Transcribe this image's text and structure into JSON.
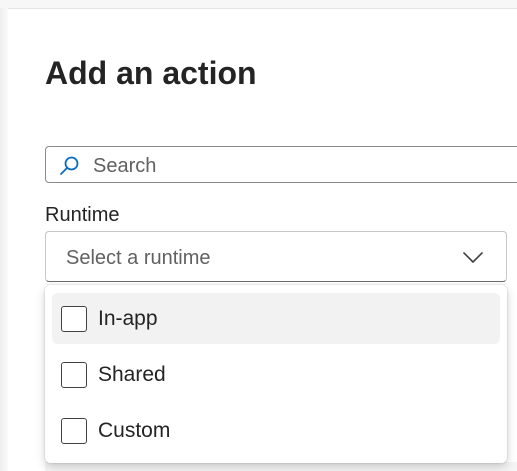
{
  "panel": {
    "title": "Add an action"
  },
  "search": {
    "placeholder": "Search",
    "icon": "search-icon"
  },
  "runtime": {
    "label": "Runtime",
    "placeholder": "Select a runtime",
    "icon": "chevron-down-icon",
    "options": [
      {
        "label": "In-app",
        "checked": false,
        "hovered": true
      },
      {
        "label": "Shared",
        "checked": false,
        "hovered": false
      },
      {
        "label": "Custom",
        "checked": false,
        "hovered": false
      }
    ]
  },
  "colors": {
    "text": "#242424",
    "placeholder": "#616161",
    "accent": "#0f6cbd",
    "hover": "#f2f2f2"
  }
}
